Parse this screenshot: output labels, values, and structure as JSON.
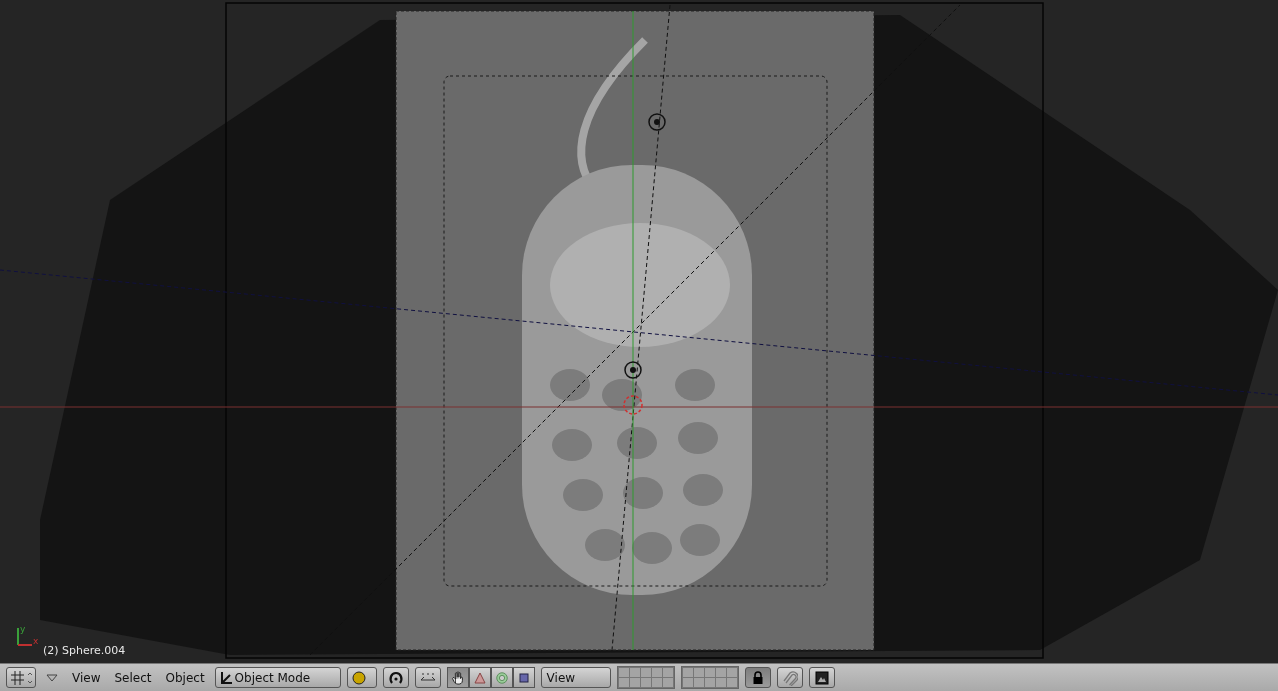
{
  "viewport": {
    "axis_labels": [
      "x",
      "y"
    ],
    "object_label": "(2) Sphere.004"
  },
  "header": {
    "menus": [
      "View",
      "Select",
      "Object"
    ],
    "mode": "Object Mode",
    "manipulators": [
      {
        "kind": "hand",
        "selected": true
      },
      {
        "kind": "translate",
        "selected": false
      },
      {
        "kind": "rotate",
        "selected": false
      },
      {
        "kind": "scale",
        "selected": false
      }
    ],
    "orientation": "View",
    "layer_lock": {
      "on": true
    }
  }
}
